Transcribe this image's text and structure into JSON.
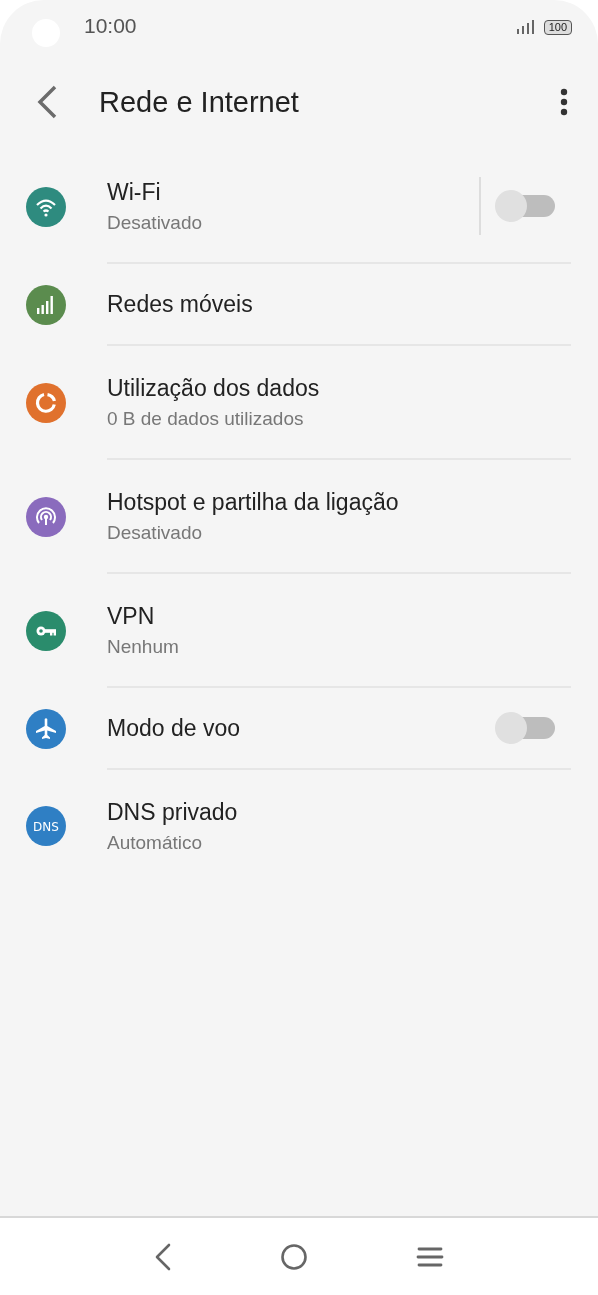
{
  "status_bar": {
    "time": "10:00",
    "battery": "100"
  },
  "toolbar": {
    "title": "Rede e Internet"
  },
  "items": [
    {
      "kind": "wifi",
      "color": "#2e8b7f",
      "title": "Wi-Fi",
      "subtitle": "Desativado",
      "toggle": {
        "on": false,
        "separated": true
      }
    },
    {
      "kind": "signal",
      "color": "#5b8c4e",
      "title": "Redes móveis"
    },
    {
      "kind": "data",
      "color": "#e0712d",
      "title": "Utilização dos dados",
      "subtitle": "0 B de dados utilizados"
    },
    {
      "kind": "hotspot",
      "color": "#8a6bbd",
      "title": "Hotspot e partilha da ligação",
      "subtitle": "Desativado"
    },
    {
      "kind": "key",
      "color": "#2a8c6c",
      "title": "VPN",
      "subtitle": "Nenhum"
    },
    {
      "kind": "plane",
      "color": "#2f7fc4",
      "title": "Modo de voo",
      "toggle": {
        "on": false,
        "separated": false
      }
    },
    {
      "kind": "dns",
      "icon_text": "DNS",
      "color": "#2f7fc4",
      "title": "DNS privado",
      "subtitle": "Automático"
    }
  ]
}
